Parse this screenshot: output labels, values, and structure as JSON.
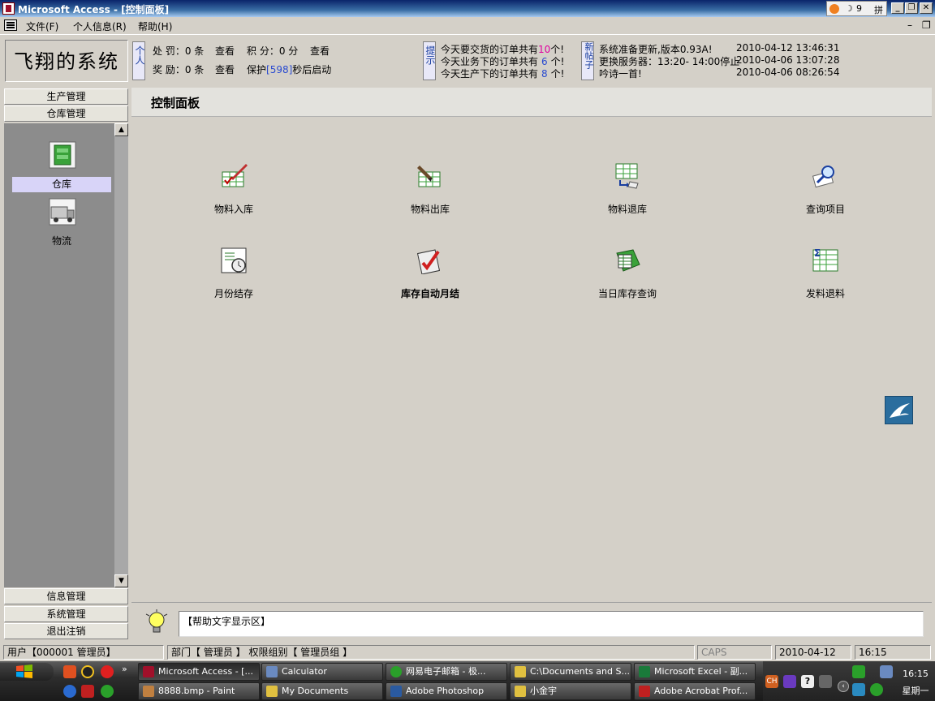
{
  "window": {
    "title": "Microsoft Access - [控制面板]",
    "ime": {
      "ime_mode": "拼",
      "ime_half": "9"
    }
  },
  "menu": {
    "items": [
      {
        "label": "文件(F)"
      },
      {
        "label": "个人信息(R)"
      },
      {
        "label": "帮助(H)"
      }
    ]
  },
  "header": {
    "system_name": "飞翔的系统",
    "personal_tag": "个人",
    "penalty_label": "处  罚：0 条",
    "penalty_view": "查看",
    "points_label": "积  分：0 分",
    "points_view": "查看",
    "reward_label": "奖  励：0 条",
    "reward_view": "查看",
    "protect_prefix": "保护",
    "protect_count": "[598]",
    "protect_suffix": "秒后启动",
    "tips_tag": "提示",
    "tips": [
      {
        "prefix": "今天要交货的订单共有",
        "count": "10",
        "suffix": "个!"
      },
      {
        "prefix": "今天业务下的订单共有",
        "count": "6",
        "suffix": "个!"
      },
      {
        "prefix": "今天生产下的订单共有",
        "count": "8",
        "suffix": "个!"
      }
    ],
    "news_tag": "新帖子",
    "news": [
      {
        "text": "系统准备更新,版本0.93A!",
        "time": "2010-04-12 13:46:31"
      },
      {
        "text": "更换服务器：13:20- 14:00停止",
        "time": "2010-04-06 13:07:28"
      },
      {
        "text": "吟诗一首!",
        "time": "2010-04-06 08:26:54"
      }
    ]
  },
  "sidebar": {
    "top_groups": [
      "生产管理",
      "仓库管理"
    ],
    "items": [
      {
        "label": "仓库",
        "icon": "warehouse-icon",
        "selected": true
      },
      {
        "label": "物流",
        "icon": "truck-icon",
        "selected": false
      }
    ],
    "bottom_groups": [
      "信息管理",
      "系统管理",
      "退出注销"
    ]
  },
  "main": {
    "title": "控制面板",
    "tiles": [
      {
        "label": "物料入库",
        "icon": "material-in-icon",
        "bold": false
      },
      {
        "label": "物料出库",
        "icon": "material-out-icon",
        "bold": false
      },
      {
        "label": "物料退库",
        "icon": "material-return-icon",
        "bold": false
      },
      {
        "label": "查询项目",
        "icon": "query-icon",
        "bold": false
      },
      {
        "label": "月份结存",
        "icon": "monthly-balance-icon",
        "bold": false
      },
      {
        "label": "库存自动月结",
        "icon": "auto-monthly-close-icon",
        "bold": true
      },
      {
        "label": "当日库存查询",
        "icon": "daily-stock-icon",
        "bold": false
      },
      {
        "label": "发料退料",
        "icon": "issue-return-icon",
        "bold": false
      }
    ]
  },
  "help": {
    "text": "【帮助文字显示区】"
  },
  "status": {
    "user": "用户【000001 管理员】",
    "dept": "部门【 管理员 】 权限组别【 管理员组 】",
    "caps": "CAPS",
    "date": "2010-04-12",
    "time": "16:15"
  },
  "taskbar": {
    "row1": [
      {
        "label": "Microsoft Access - [...",
        "color": "#a0102a",
        "active": true
      },
      {
        "label": "Calculator",
        "color": "#6a8ac0",
        "active": false
      },
      {
        "label": "网易电子邮箱 - 极...",
        "color": "#2aa02a",
        "active": false
      },
      {
        "label": "C:\\Documents and S...",
        "color": "#e0c040",
        "active": false
      },
      {
        "label": "Microsoft Excel - 副...",
        "color": "#1a7a3a",
        "active": false
      }
    ],
    "row2": [
      {
        "label": "8888.bmp - Paint",
        "color": "#c08040",
        "active": false
      },
      {
        "label": "My Documents",
        "color": "#e0c040",
        "active": false
      },
      {
        "label": "Adobe Photoshop",
        "color": "#2a5aa0",
        "active": false
      },
      {
        "label": "小金宇",
        "color": "#e0c040",
        "active": false
      },
      {
        "label": "Adobe Acrobat Prof...",
        "color": "#c02020",
        "active": false
      }
    ],
    "clock_time": "16:15",
    "clock_day": "星期一"
  },
  "colors": {
    "title_start": "#0a246a",
    "title_end": "#a6caf0",
    "sidebar_selected": "#d8d4f8",
    "accent_blue": "#2a4bd0",
    "accent_pink": "#e000a0"
  }
}
